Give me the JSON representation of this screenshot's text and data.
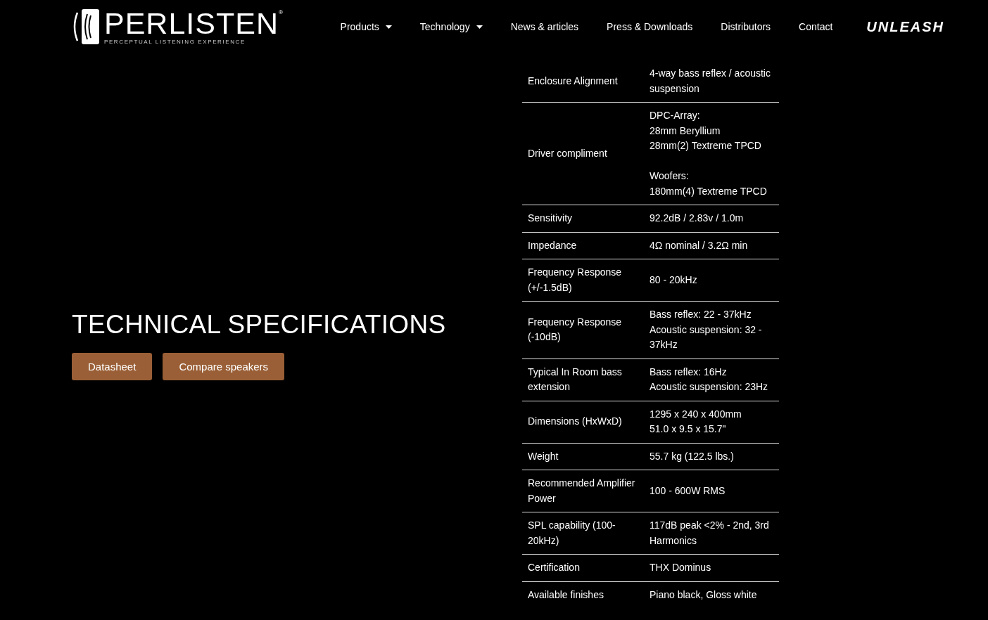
{
  "header": {
    "logo": {
      "name": "PERLISTEN",
      "mark": "®",
      "tagline": "PERCEPTUAL LISTENING EXPERIENCE"
    },
    "nav": [
      {
        "label": "Products",
        "dropdown": true
      },
      {
        "label": "Technology",
        "dropdown": true
      },
      {
        "label": "News & articles",
        "dropdown": false
      },
      {
        "label": "Press & Downloads",
        "dropdown": false
      },
      {
        "label": "Distributors",
        "dropdown": false
      },
      {
        "label": "Contact",
        "dropdown": false
      }
    ],
    "unleash": "UNLEASH"
  },
  "heading": "TECHNICAL SPECIFICATIONS",
  "buttons": [
    "Datasheet",
    "Compare speakers"
  ],
  "specs": [
    {
      "label": "Enclosure Alignment",
      "value": [
        [
          "4-way bass reflex / acoustic suspension"
        ]
      ]
    },
    {
      "label": "Driver compliment",
      "value": [
        [
          "DPC-Array:",
          "28mm Beryllium",
          "28mm(2) Textreme TPCD"
        ],
        [
          "Woofers:",
          "180mm(4) Textreme TPCD"
        ]
      ]
    },
    {
      "label": "Sensitivity",
      "value": [
        [
          "92.2dB / 2.83v / 1.0m"
        ]
      ]
    },
    {
      "label": "Impedance",
      "value": [
        [
          "4Ω nominal / 3.2Ω min"
        ]
      ]
    },
    {
      "label": "Frequency Response (+/-1.5dB)",
      "value": [
        [
          "80 - 20kHz"
        ]
      ]
    },
    {
      "label": "Frequency Response (-10dB)",
      "value": [
        [
          "Bass reflex: 22 - 37kHz",
          "Acoustic suspension: 32 - 37kHz"
        ]
      ]
    },
    {
      "label": "Typical In Room bass extension",
      "value": [
        [
          "Bass reflex: 16Hz",
          "Acoustic suspension: 23Hz"
        ]
      ]
    },
    {
      "label": "Dimensions (HxWxD)",
      "value": [
        [
          "1295 x 240 x 400mm",
          "51.0 x 9.5 x 15.7\""
        ]
      ]
    },
    {
      "label": "Weight",
      "value": [
        [
          "55.7 kg (122.5 lbs.)"
        ]
      ]
    },
    {
      "label": "Recommended Amplifier Power",
      "value": [
        [
          "100 - 600W RMS"
        ]
      ]
    },
    {
      "label": "SPL capability (100-20kHz)",
      "value": [
        [
          "117dB peak <2% - 2nd, 3rd Harmonics"
        ]
      ]
    },
    {
      "label": "Certification",
      "value": [
        [
          "THX Dominus"
        ]
      ]
    },
    {
      "label": "Available finishes",
      "value": [
        [
          "Piano black, Gloss white"
        ]
      ]
    }
  ]
}
